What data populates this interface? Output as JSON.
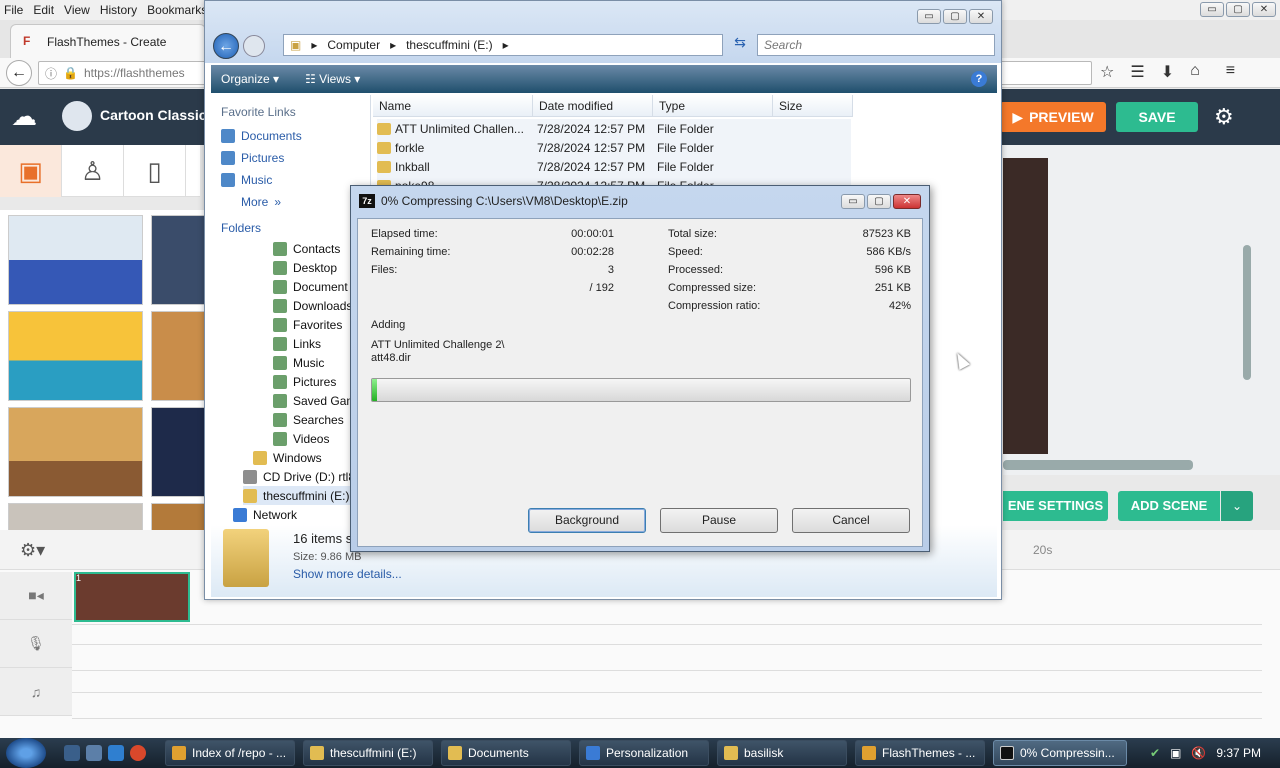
{
  "firefox": {
    "menu": [
      "File",
      "Edit",
      "View",
      "History",
      "Bookmarks"
    ],
    "tab_title": "FlashThemes - Create",
    "url": "https://flashthemes",
    "ctrl_min": "▭",
    "ctrl_max": "▢",
    "ctrl_close": "✕"
  },
  "app": {
    "theme_name": "Cartoon Classics",
    "preview_label": "PREVIEW",
    "save_label": "SAVE",
    "scene_settings_label": "ENE SETTINGS",
    "add_scene_label": "ADD SCENE",
    "timeline_time": "20s",
    "scene_number": "1"
  },
  "explorer": {
    "address": [
      "Computer",
      "thescuffmini (E:)"
    ],
    "search_placeholder": "Search",
    "toolbar": {
      "organize": "Organize",
      "views": "Views"
    },
    "favorite_links_header": "Favorite Links",
    "favorite_links": [
      "Documents",
      "Pictures",
      "Music",
      "More"
    ],
    "folders_header": "Folders",
    "tree": [
      "Contacts",
      "Desktop",
      "Document",
      "Downloads",
      "Favorites",
      "Links",
      "Music",
      "Pictures",
      "Saved Gam",
      "Searches",
      "Videos",
      "Windows",
      "CD Drive (D:) rtl8",
      "thescuffmini (E:)",
      "Network"
    ],
    "columns": [
      "Name",
      "Date modified",
      "Type",
      "Size"
    ],
    "files": [
      {
        "name": "ATT Unlimited Challen...",
        "date": "7/28/2024 12:57 PM",
        "type": "File Folder"
      },
      {
        "name": "forkle",
        "date": "7/28/2024 12:57 PM",
        "type": "File Folder"
      },
      {
        "name": "Inkball",
        "date": "7/28/2024 12:57 PM",
        "type": "File Folder"
      },
      {
        "name": "poke98",
        "date": "7/28/2024 12:57 PM",
        "type": "File Folder"
      }
    ],
    "details": {
      "items": "16 items s",
      "size": "Size: 9.86 MB",
      "more": "Show more details..."
    }
  },
  "zip": {
    "logo": "7z",
    "title": "0% Compressing C:\\Users\\VM8\\Desktop\\E.zip",
    "left": [
      {
        "label": "Elapsed time:",
        "value": "00:00:01"
      },
      {
        "label": "Remaining time:",
        "value": "00:02:28"
      },
      {
        "label": "Files:",
        "value": "3"
      },
      {
        "label": "",
        "value": "/ 192"
      }
    ],
    "right": [
      {
        "label": "Total size:",
        "value": "87523 KB"
      },
      {
        "label": "Speed:",
        "value": "586 KB/s"
      },
      {
        "label": "Processed:",
        "value": "596 KB"
      },
      {
        "label": "Compressed size:",
        "value": "251 KB"
      },
      {
        "label": "Compression ratio:",
        "value": "42%"
      }
    ],
    "adding_label": "Adding",
    "current_path": "ATT Unlimited Challenge 2\\",
    "current_file": "att48.dir",
    "progress_percent": 0.01,
    "buttons": {
      "background": "Background",
      "pause": "Pause",
      "cancel": "Cancel"
    }
  },
  "taskbar": {
    "buttons": [
      {
        "label": "Index of /repo - ...",
        "color": "#e0a030"
      },
      {
        "label": "thescuffmini (E:)",
        "color": "#e2bc52"
      },
      {
        "label": "Documents",
        "color": "#e2bc52"
      },
      {
        "label": "Personalization",
        "color": "#3a7bd5"
      },
      {
        "label": "basilisk",
        "color": "#e2bc52"
      },
      {
        "label": "FlashThemes - ...",
        "color": "#e0a030"
      },
      {
        "label": "0% Compressin...",
        "color": "#111111"
      }
    ],
    "clock": "9:37 PM"
  }
}
